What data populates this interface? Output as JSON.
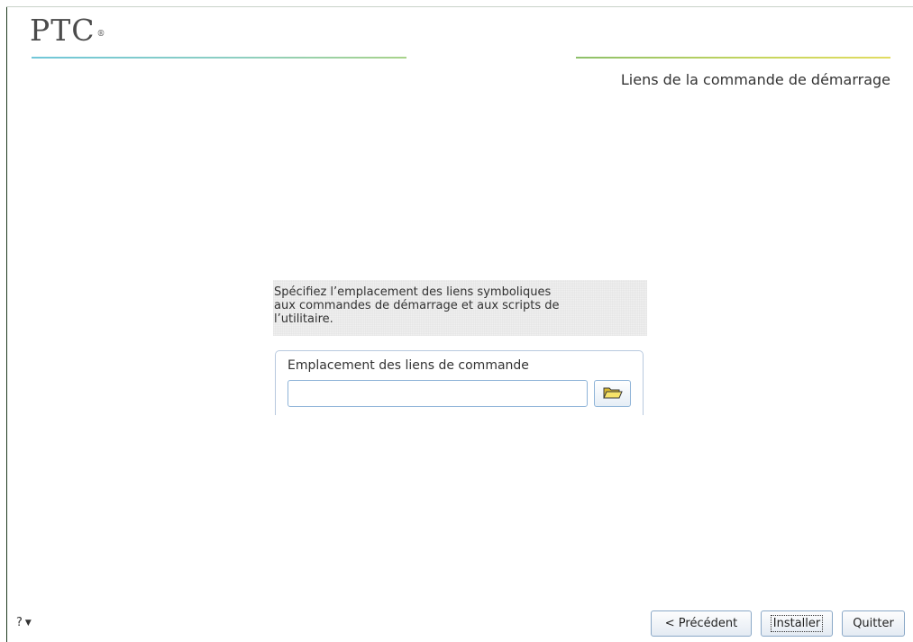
{
  "brand": {
    "logo_text": "PTC",
    "logo_mark": "®"
  },
  "header": {
    "page_title": "Liens de la commande de démarrage"
  },
  "content": {
    "description_lines": [
      "Spécifiez l’emplacement des liens symboliques",
      "aux commandes de démarrage et aux scripts de",
      "l’utilitaire."
    ],
    "group_label": "Emplacement des liens de commande",
    "path_value": ""
  },
  "icons": {
    "browse": "folder-icon",
    "help_menu": "caret-down-icon"
  },
  "footer": {
    "help_label": "?",
    "help_caret": "▼",
    "buttons": {
      "previous": "< Précédent",
      "install": "Installer",
      "quit": "Quitter"
    }
  },
  "colors": {
    "accent_line_left": "#71c7d9",
    "accent_line_right": "#c7d65e",
    "input_border": "#8fb4d8"
  }
}
